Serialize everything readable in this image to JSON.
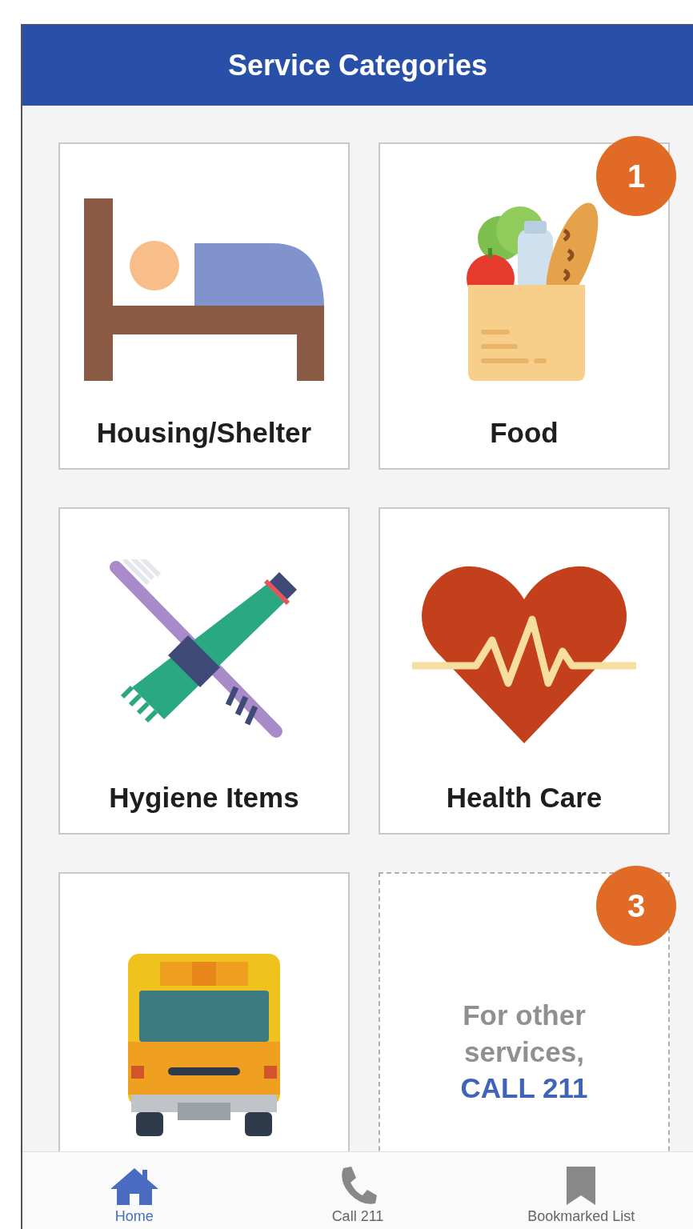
{
  "header": {
    "title": "Service Categories"
  },
  "tiles": [
    {
      "kind": "category",
      "label": "Housing/Shelter"
    },
    {
      "kind": "category",
      "label": "Food",
      "badge": "1"
    },
    {
      "kind": "category",
      "label": "Hygiene Items"
    },
    {
      "kind": "category",
      "label": "Health Care"
    },
    {
      "kind": "category"
    },
    {
      "kind": "info",
      "text": "For other services,",
      "link": "CALL 211",
      "badge": "3"
    }
  ],
  "nav": [
    {
      "label": "Home",
      "selected": true
    },
    {
      "label": "Call 211",
      "selected": false
    },
    {
      "label": "Bookmarked List",
      "selected": false
    }
  ]
}
